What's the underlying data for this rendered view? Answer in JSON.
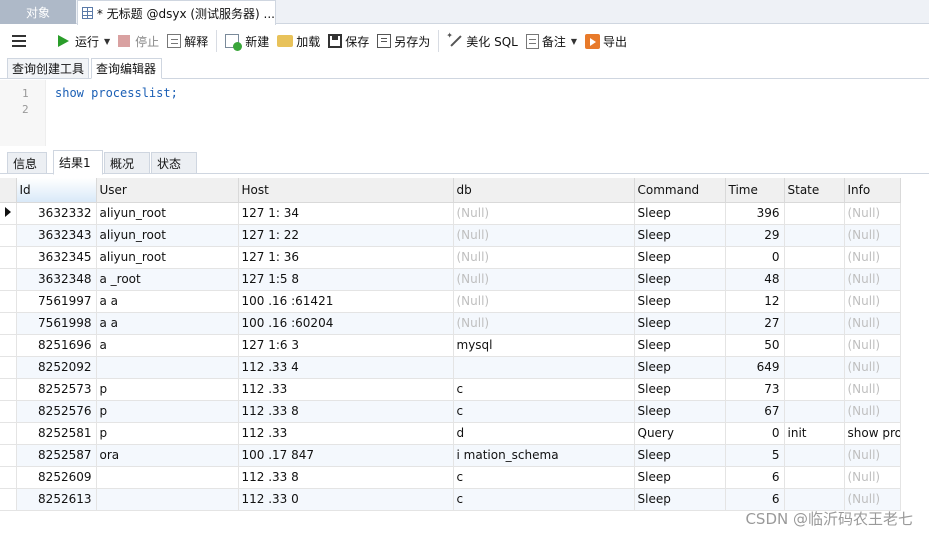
{
  "top_tabs": {
    "objects_label": "对象",
    "query_tab_label": "* 无标题 @dsyx (测试服务器) ..."
  },
  "toolbar": {
    "run": "运行",
    "stop": "停止",
    "explain": "解释",
    "new": "新建",
    "load": "加载",
    "save": "保存",
    "save_as": "另存为",
    "beautify": "美化 SQL",
    "note": "备注",
    "export": "导出"
  },
  "editor_tabs": {
    "builder": "查询创建工具",
    "editor": "查询编辑器"
  },
  "editor": {
    "line_numbers": [
      "1",
      "2"
    ],
    "code": "show processlist;"
  },
  "result_tabs": {
    "info": "信息",
    "result1": "结果1",
    "overview": "概况",
    "status": "状态"
  },
  "grid": {
    "columns": [
      "Id",
      "User",
      "Host",
      "db",
      "Command",
      "Time",
      "State",
      "Info"
    ],
    "rows": [
      [
        "3632332",
        "aliyun_root",
        "127 1: 34",
        "(Null)",
        "Sleep",
        "396",
        "",
        "(Null)"
      ],
      [
        "3632343",
        "aliyun_root",
        "127 1: 22",
        "(Null)",
        "Sleep",
        "29",
        "",
        "(Null)"
      ],
      [
        "3632345",
        "aliyun_root",
        "127 1: 36",
        "(Null)",
        "Sleep",
        "0",
        "",
        "(Null)"
      ],
      [
        "3632348",
        "a _root",
        "127 1:5 8",
        "(Null)",
        "Sleep",
        "48",
        "",
        "(Null)"
      ],
      [
        "7561997",
        "a a",
        "100 .16 :61421",
        "(Null)",
        "Sleep",
        "12",
        "",
        "(Null)"
      ],
      [
        "7561998",
        "a a",
        "100 .16 :60204",
        "(Null)",
        "Sleep",
        "27",
        "",
        "(Null)"
      ],
      [
        "8251696",
        "a",
        "127 1:6 3",
        "mysql",
        "Sleep",
        "50",
        "",
        "(Null)"
      ],
      [
        "8252092",
        "",
        "112 .33 4",
        "",
        "Sleep",
        "649",
        "",
        "(Null)"
      ],
      [
        "8252573",
        "p",
        "112 .33",
        "c",
        "Sleep",
        "73",
        "",
        "(Null)"
      ],
      [
        "8252576",
        "p",
        "112 .33 8",
        "c",
        "Sleep",
        "67",
        "",
        "(Null)"
      ],
      [
        "8252581",
        "p",
        "112 .33",
        "d",
        "Query",
        "0",
        "init",
        "show pro"
      ],
      [
        "8252587",
        "ora",
        "100 .17 847",
        "i mation_schema",
        "Sleep",
        "5",
        "",
        "(Null)"
      ],
      [
        "8252609",
        "",
        "112 .33 8",
        "c",
        "Sleep",
        "6",
        "",
        "(Null)"
      ],
      [
        "8252613",
        "",
        "112 .33 0",
        "c",
        "Sleep",
        "6",
        "",
        "(Null)"
      ]
    ]
  },
  "watermark": "CSDN @临沂码农王老七"
}
